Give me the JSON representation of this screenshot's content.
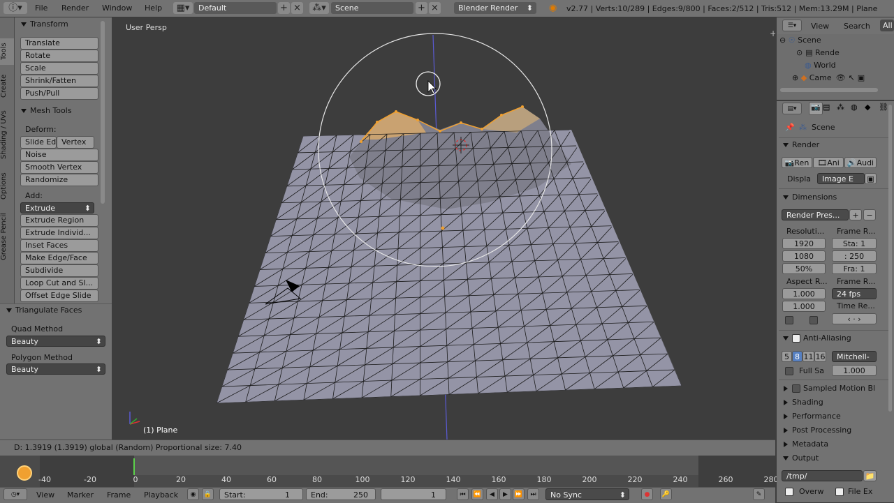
{
  "topbar": {
    "menus": [
      "File",
      "Render",
      "Window",
      "Help"
    ],
    "layout_value": "Default",
    "scene_value": "Scene",
    "engine_value": "Blender Render",
    "stats": "v2.77 | Verts:10/289 | Edges:9/800 | Faces:2/512 | Tris:512 | Mem:13.29M | Plane"
  },
  "left_tabs": [
    "Tools",
    "Create",
    "Shading / UVs",
    "Options",
    "Grease Pencil"
  ],
  "tool_shelf": {
    "transform_title": "Transform",
    "transform_buttons": [
      "Translate",
      "Rotate",
      "Scale",
      "Shrink/Fatten",
      "Push/Pull"
    ],
    "mesh_tools_title": "Mesh Tools",
    "deform_label": "Deform:",
    "slide_edge": "Slide Ed",
    "vertex": "Vertex",
    "deform_buttons": [
      "Noise",
      "Smooth Vertex",
      "Randomize"
    ],
    "add_label": "Add:",
    "extrude_dropdown": "Extrude",
    "add_buttons": [
      "Extrude Region",
      "Extrude Individ...",
      "Inset Faces",
      "Make Edge/Face",
      "Subdivide",
      "Loop Cut and Sl...",
      "Offset Edge Slide"
    ],
    "triangulate_title": "Triangulate Faces",
    "quad_label": "Quad Method",
    "quad_value": "Beauty",
    "polygon_label": "Polygon Method",
    "polygon_value": "Beauty"
  },
  "viewport": {
    "view_label": "User Persp",
    "object_label": "(1) Plane"
  },
  "status": "D: 1.3919 (1.3919) global (Random)   Proportional size: 7.40",
  "timeline": {
    "ticks": [
      "-40",
      "-20",
      "0",
      "20",
      "40",
      "60",
      "80",
      "100",
      "120",
      "140",
      "160",
      "180",
      "200",
      "220",
      "240",
      "260",
      "280"
    ],
    "menus": [
      "View",
      "Marker",
      "Frame",
      "Playback"
    ],
    "start_label": "Start:",
    "start_value": "1",
    "end_label": "End:",
    "end_value": "250",
    "current_value": "1",
    "sync_value": "No Sync"
  },
  "outliner": {
    "menus": [
      "View",
      "Search",
      "All"
    ],
    "rows": [
      "Scene",
      "Rende",
      "World",
      "Came"
    ]
  },
  "properties": {
    "context": "Scene",
    "render_title": "Render",
    "render_buttons": [
      "Ren",
      "Ani",
      "Audi"
    ],
    "display_label": "Displa",
    "display_value": "Image E",
    "dimensions_title": "Dimensions",
    "preset_value": "Render Pres...",
    "resolution_label": "Resoluti...",
    "res_x": "1920",
    "res_y": "1080",
    "res_pct": "50%",
    "frame_range_label": "Frame R...",
    "frame_start": "Sta: 1",
    "frame_end": ": 250",
    "frame_step": "Fra: 1",
    "aspect_label": "Aspect R...",
    "aspect_x": "1.000",
    "aspect_y": "1.000",
    "frame_rate_label": "Frame R...",
    "fps_value": "24 fps",
    "time_remap_label": "Time Re...",
    "aa_title": "Anti-Aliasing",
    "aa_samples": [
      "5",
      "8",
      "11",
      "16"
    ],
    "filter_value": "Mitchell-",
    "full_sample_label": "Full Sa",
    "filter_size": "1.000",
    "sampled_motion": "Sampled Motion Bl",
    "collapsed_panels": [
      "Shading",
      "Performance",
      "Post Processing",
      "Metadata"
    ],
    "output_title": "Output",
    "output_path": "/tmp/",
    "overwrite_label": "Overw",
    "file_ext_label": "File Ex"
  },
  "colors": {
    "selection": "#f0a030",
    "mesh_face": "#9494a6",
    "axis_blue": "#5b5bd6"
  }
}
